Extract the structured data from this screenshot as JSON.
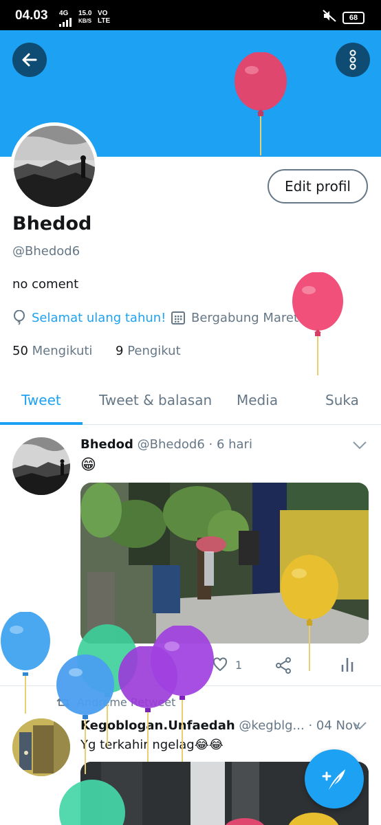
{
  "status_bar": {
    "time": "04.03",
    "network": "4G",
    "speed_value": "15.0",
    "speed_unit": "KB/S",
    "volte_top": "VO",
    "volte_bottom": "LTE",
    "battery": "68"
  },
  "profile": {
    "name": "Bhedod",
    "handle": "@Bhedod6",
    "bio": "no coment",
    "birthday_text": "Selamat ulang tahun!",
    "joined_text": "Bergabung Maret 2020",
    "following_count": "50",
    "following_label": "Mengikuti",
    "followers_count": "9",
    "followers_label": "Pengikut",
    "edit_button": "Edit profil"
  },
  "tabs": [
    {
      "label": "Tweet",
      "active": true
    },
    {
      "label": "Tweet & balasan",
      "active": false
    },
    {
      "label": "Media",
      "active": false
    },
    {
      "label": "Suka",
      "active": false
    }
  ],
  "tweets": [
    {
      "author": "Bhedod",
      "handle_time": "@Bhedod6 · 6 hari",
      "text": "😁",
      "like_count": "1"
    },
    {
      "retweet_by": "Andreme Retweet",
      "author": "Kegoblogan.Unfaedah",
      "handle": "@kegblg...",
      "time": " · 04 Nov",
      "text": "Yg terkahir ngelag😂😂"
    }
  ],
  "colors": {
    "brand": "#1da1f2",
    "banner": "#1da1f2",
    "button_dark": "#0f4c73",
    "text_secondary": "#657786"
  },
  "icons": [
    "back-arrow-icon",
    "more-vertical-icon",
    "balloon-icon",
    "calendar-icon",
    "chevron-down-icon",
    "reply-icon",
    "retweet-icon",
    "like-icon",
    "share-icon",
    "stats-icon",
    "compose-icon"
  ]
}
